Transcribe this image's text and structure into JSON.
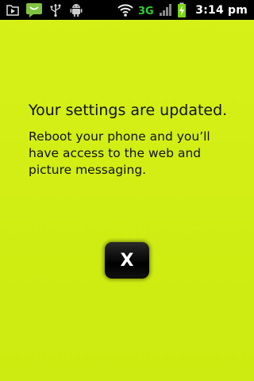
{
  "status_bar": {
    "time": "3:14 pm",
    "network_type": "3G",
    "left_icons": [
      "media-play-icon",
      "message-icon",
      "usb-icon",
      "android-debug-icon"
    ],
    "right_icons": [
      "wifi-icon",
      "network-3g-icon",
      "signal-icon",
      "battery-charging-icon"
    ],
    "network_color": "#32cd32",
    "battery_level": 0.75
  },
  "main": {
    "title": "Your settings are updated.",
    "message": "Reboot your phone and you’ll have access to the web and picture messaging.",
    "close_label": "X"
  },
  "colors": {
    "background": "#d2ee14",
    "text": "#111111",
    "button": "#000000",
    "status_bar": "#000000",
    "message_icon": "#7fc241",
    "battery": "#7cd31a"
  }
}
